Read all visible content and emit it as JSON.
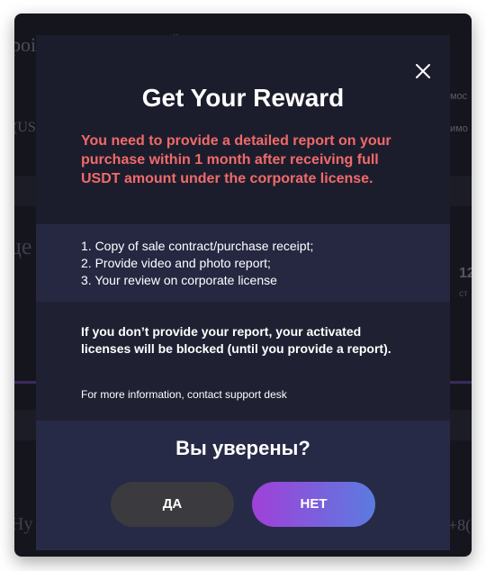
{
  "background": {
    "title_fragment": "роі",
    "top_fragment": "й",
    "right_fragment_1": "мос",
    "right_fragment_2": "имо",
    "left_fragment_1": "(UЅ",
    "left_fragment_2": "це",
    "number_fragment": "12",
    "number_sub_fragment": "ст",
    "bottom_left_fragment": "Ну",
    "bottom_right_fragment": "+8("
  },
  "modal": {
    "title": "Get Your Reward",
    "warning": "You need to provide a detailed report on your purchase within 1 month after receiving full USDT amount under the corporate license.",
    "requirements": [
      "1. Copy of sale contract/purchase receipt;",
      "2. Provide video and photo report;",
      "3. Your review on corporate license"
    ],
    "blocked_notice": "If you don’t provide your report, your activated licenses will be blocked (until you provide a report).",
    "support_text": "For more information, contact support desk",
    "confirm_question": "Вы уверены?",
    "yes_label": "ДА",
    "no_label": "НЕТ"
  },
  "colors": {
    "warning": "#f06a6a",
    "modal_bg": "#272a46",
    "yes_button": "#3a3a3f",
    "no_button_start": "#a040d8",
    "no_button_end": "#5b7be0"
  },
  "icons": {
    "close": "close-icon"
  }
}
